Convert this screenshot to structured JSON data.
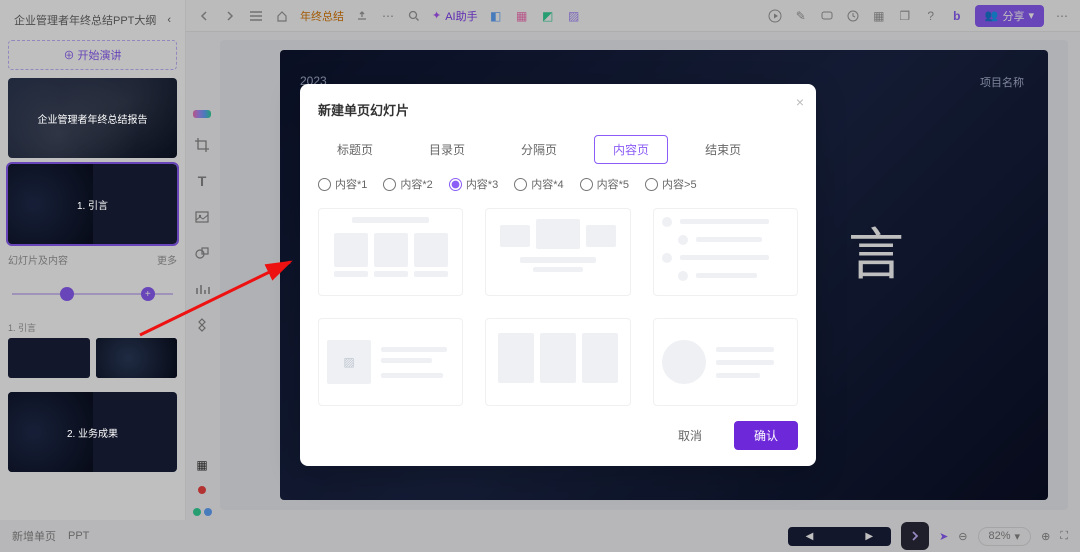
{
  "doc": {
    "title": "企业管理者年终总结PPT大纲"
  },
  "sidebar": {
    "start_button": "⊕ 开始演讲",
    "cover_title": "企业管理者年终总结报告",
    "slide1_label": "1. 引言",
    "section_header": "幻灯片及内容",
    "section_more": "更多",
    "mini_label": "1. 引言",
    "slide2_label": "2. 业务成果"
  },
  "toolbar": {
    "breadcrumb": "年终总结",
    "ai": "AI助手",
    "share": "分享"
  },
  "slide": {
    "year": "2023",
    "project": "项目名称",
    "big_text": "言"
  },
  "modal": {
    "title": "新建单页幻灯片",
    "tabs": [
      "标题页",
      "目录页",
      "分隔页",
      "内容页",
      "结束页"
    ],
    "active_tab": 3,
    "radios": [
      "内容*1",
      "内容*2",
      "内容*3",
      "内容*4",
      "内容*5",
      "内容>5"
    ],
    "radio_checked": 2,
    "cancel": "取消",
    "confirm": "确认"
  },
  "bottombar": {
    "left1": "新增单页",
    "left2": "PPT",
    "zoom": "82%"
  }
}
